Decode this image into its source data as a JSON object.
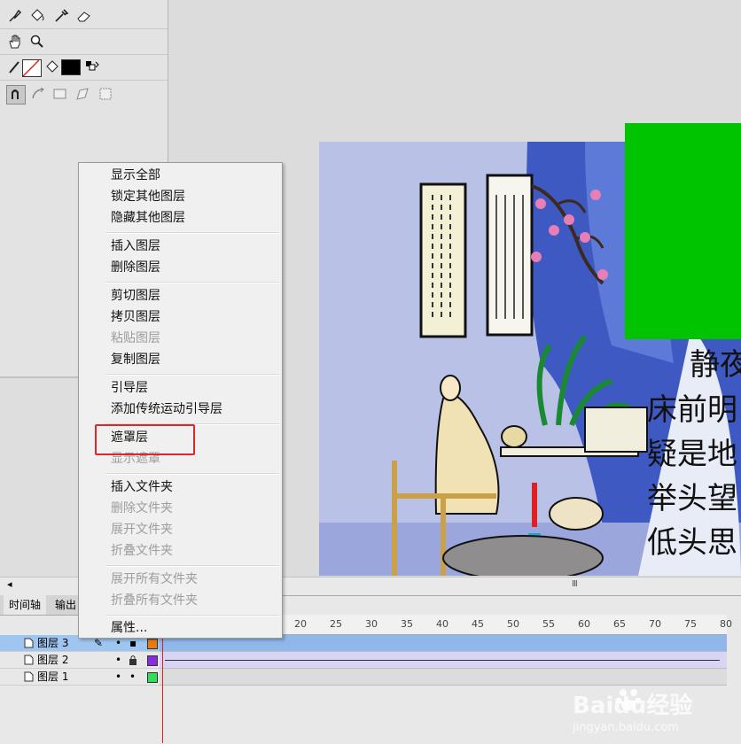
{
  "context_menu": {
    "items": [
      {
        "label": "显示全部",
        "enabled": true
      },
      {
        "label": "锁定其他图层",
        "enabled": true
      },
      {
        "label": "隐藏其他图层",
        "enabled": true
      },
      {
        "label": "插入图层",
        "enabled": true
      },
      {
        "label": "删除图层",
        "enabled": true
      },
      {
        "label": "剪切图层",
        "enabled": true
      },
      {
        "label": "拷贝图层",
        "enabled": true
      },
      {
        "label": "粘贴图层",
        "enabled": false
      },
      {
        "label": "复制图层",
        "enabled": true
      },
      {
        "label": "引导层",
        "enabled": true
      },
      {
        "label": "添加传统运动引导层",
        "enabled": true
      },
      {
        "label": "遮罩层",
        "enabled": true,
        "highlighted": true
      },
      {
        "label": "显示遮罩",
        "enabled": false
      },
      {
        "label": "插入文件夹",
        "enabled": true
      },
      {
        "label": "删除文件夹",
        "enabled": false
      },
      {
        "label": "展开文件夹",
        "enabled": false
      },
      {
        "label": "折叠文件夹",
        "enabled": false
      },
      {
        "label": "展开所有文件夹",
        "enabled": false
      },
      {
        "label": "折叠所有文件夹",
        "enabled": false
      },
      {
        "label": "属性...",
        "enabled": true
      }
    ],
    "highlight_color": "#e0262a"
  },
  "timeline": {
    "tabs": [
      "时间轴",
      "输出"
    ],
    "ruler_ticks": [
      "20",
      "25",
      "30",
      "35",
      "40",
      "45",
      "50",
      "55",
      "60",
      "65",
      "70",
      "75",
      "80"
    ],
    "layers": [
      {
        "name": "图层 3",
        "selected": true,
        "color": "#e87b12"
      },
      {
        "name": "图层 2",
        "selected": false,
        "color": "#8a2be2"
      },
      {
        "name": "图层 1",
        "selected": false,
        "color": "#33dd55"
      }
    ],
    "scroll_grip": "III"
  },
  "stage": {
    "poem_lines": [
      "静夜",
      "床前明",
      "疑是地",
      "举头望",
      "低头思"
    ],
    "mask_color": "#00c400",
    "artwork_bg": "#b9c2e6"
  },
  "tools": {
    "icons": [
      "subselect-icon",
      "paint-bucket-icon",
      "eyedropper-icon",
      "eraser-icon",
      "hand-icon",
      "zoom-icon",
      "stroke-color-icon",
      "fill-color-icon",
      "swap-colors-icon",
      "snap-magnet-icon",
      "smooth-icon",
      "straighten-icon",
      "rotate-icon",
      "scale-icon"
    ],
    "fill_color": "#000000"
  },
  "watermark": {
    "brand": "Baidu经验",
    "url": "jingyan.baidu.com"
  }
}
